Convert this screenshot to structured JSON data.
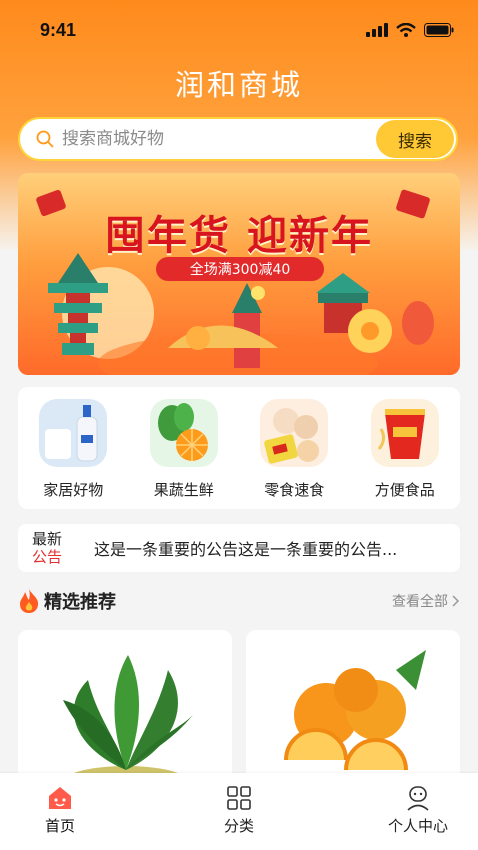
{
  "status": {
    "time": "9:41"
  },
  "app": {
    "title": "润和商城"
  },
  "search": {
    "placeholder": "搜索商城好物",
    "button": "搜索"
  },
  "banner": {
    "title": "囤年货 迎新年",
    "subtitle": "全场满300减40"
  },
  "categories": [
    {
      "label": "家居好物",
      "icon": "household-icon"
    },
    {
      "label": "果蔬生鲜",
      "icon": "produce-icon"
    },
    {
      "label": "零食速食",
      "icon": "snacks-icon"
    },
    {
      "label": "方便食品",
      "icon": "instant-noodles-icon"
    }
  ],
  "notice": {
    "tag_top": "最新",
    "tag_bottom": "公告",
    "text": "这是一条重要的公告这是一条重要的公告..."
  },
  "featured": {
    "title": "精选推荐",
    "more": "查看全部"
  },
  "tabs": [
    {
      "label": "首页",
      "icon": "home-icon",
      "active": true
    },
    {
      "label": "分类",
      "icon": "grid-icon",
      "active": false
    },
    {
      "label": "个人中心",
      "icon": "user-icon",
      "active": false
    }
  ],
  "colors": {
    "accent": "#ff8a1c",
    "search_button": "#ffc935",
    "notice_red": "#e53030",
    "active_tab": "#e53030"
  }
}
